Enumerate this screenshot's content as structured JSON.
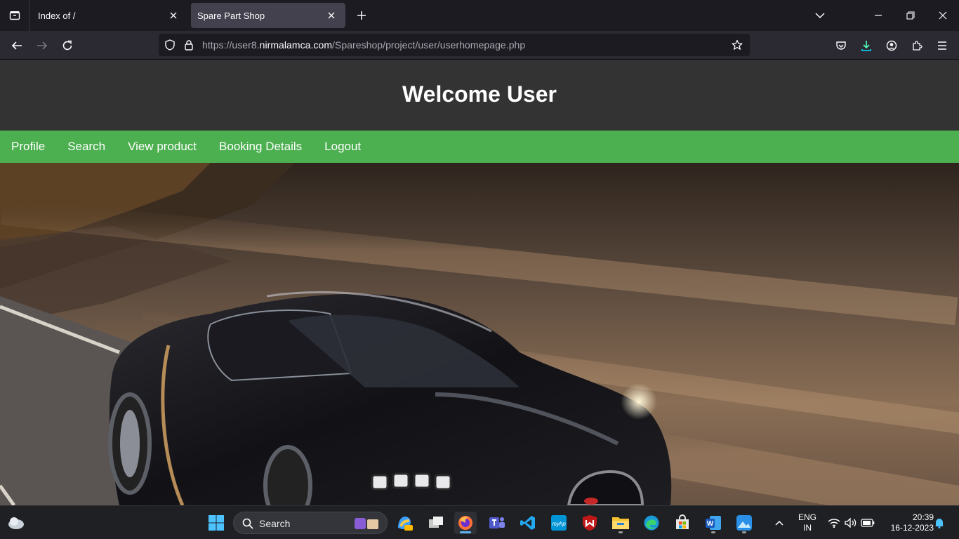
{
  "browser": {
    "tabs": [
      {
        "title": "Index of /",
        "active": false
      },
      {
        "title": "Spare Part Shop",
        "active": true
      }
    ],
    "url": {
      "prefix": "https://user8.",
      "host": "nirmalamca.com",
      "path": "/Spareshop/project/user/userhomepage.php"
    }
  },
  "page": {
    "header_title": "Welcome User",
    "menu": [
      {
        "label": "Profile"
      },
      {
        "label": "Search"
      },
      {
        "label": "View product"
      },
      {
        "label": "Booking Details"
      },
      {
        "label": "Logout"
      }
    ],
    "hero_image": "sports-car-on-road"
  },
  "taskbar": {
    "search_label": "Search",
    "language": {
      "line1": "ENG",
      "line2": "IN"
    },
    "time": "20:39",
    "date": "16-12-2023"
  },
  "colors": {
    "header_bg": "#333333",
    "menu_bg": "#4caf50",
    "browser_bg": "#1c1b22",
    "active_tab": "#42414d"
  }
}
